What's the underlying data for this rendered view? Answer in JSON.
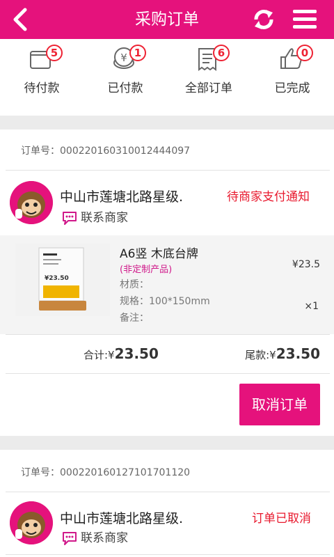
{
  "header": {
    "title": "采购订单"
  },
  "tabs": [
    {
      "label": "待付款",
      "count": "5",
      "icon": "wallet-icon"
    },
    {
      "label": "已付款",
      "count": "1",
      "icon": "yen-coin-icon"
    },
    {
      "label": "全部订单",
      "count": "6",
      "icon": "receipt-icon"
    },
    {
      "label": "已完成",
      "count": "0",
      "icon": "thumbs-up-icon"
    }
  ],
  "orders": [
    {
      "order_no": "订单号：000220160310012444097",
      "shop": "中山市莲塘北路星级.",
      "status": "待商家支付通知",
      "contact": "联系商家",
      "product": {
        "name": "A6竖 木底台牌",
        "tag": "(非定制产品)",
        "material": "材质：",
        "size": "规格：100*150mm",
        "note": "备注：",
        "price": "¥23.5",
        "qty": "×1",
        "thumb_price": "¥23.50"
      },
      "total_label": "合计:¥",
      "total_value": "23.50",
      "tail_label": "尾款:¥",
      "tail_value": "23.50",
      "action": "取消订单"
    },
    {
      "order_no": "订单号：000220160127101701120",
      "shop": "中山市莲塘北路星级.",
      "status": "订单已取消",
      "contact": "联系商家"
    }
  ],
  "colors": {
    "brand": "#e5127c",
    "status_red": "#e8182d"
  }
}
